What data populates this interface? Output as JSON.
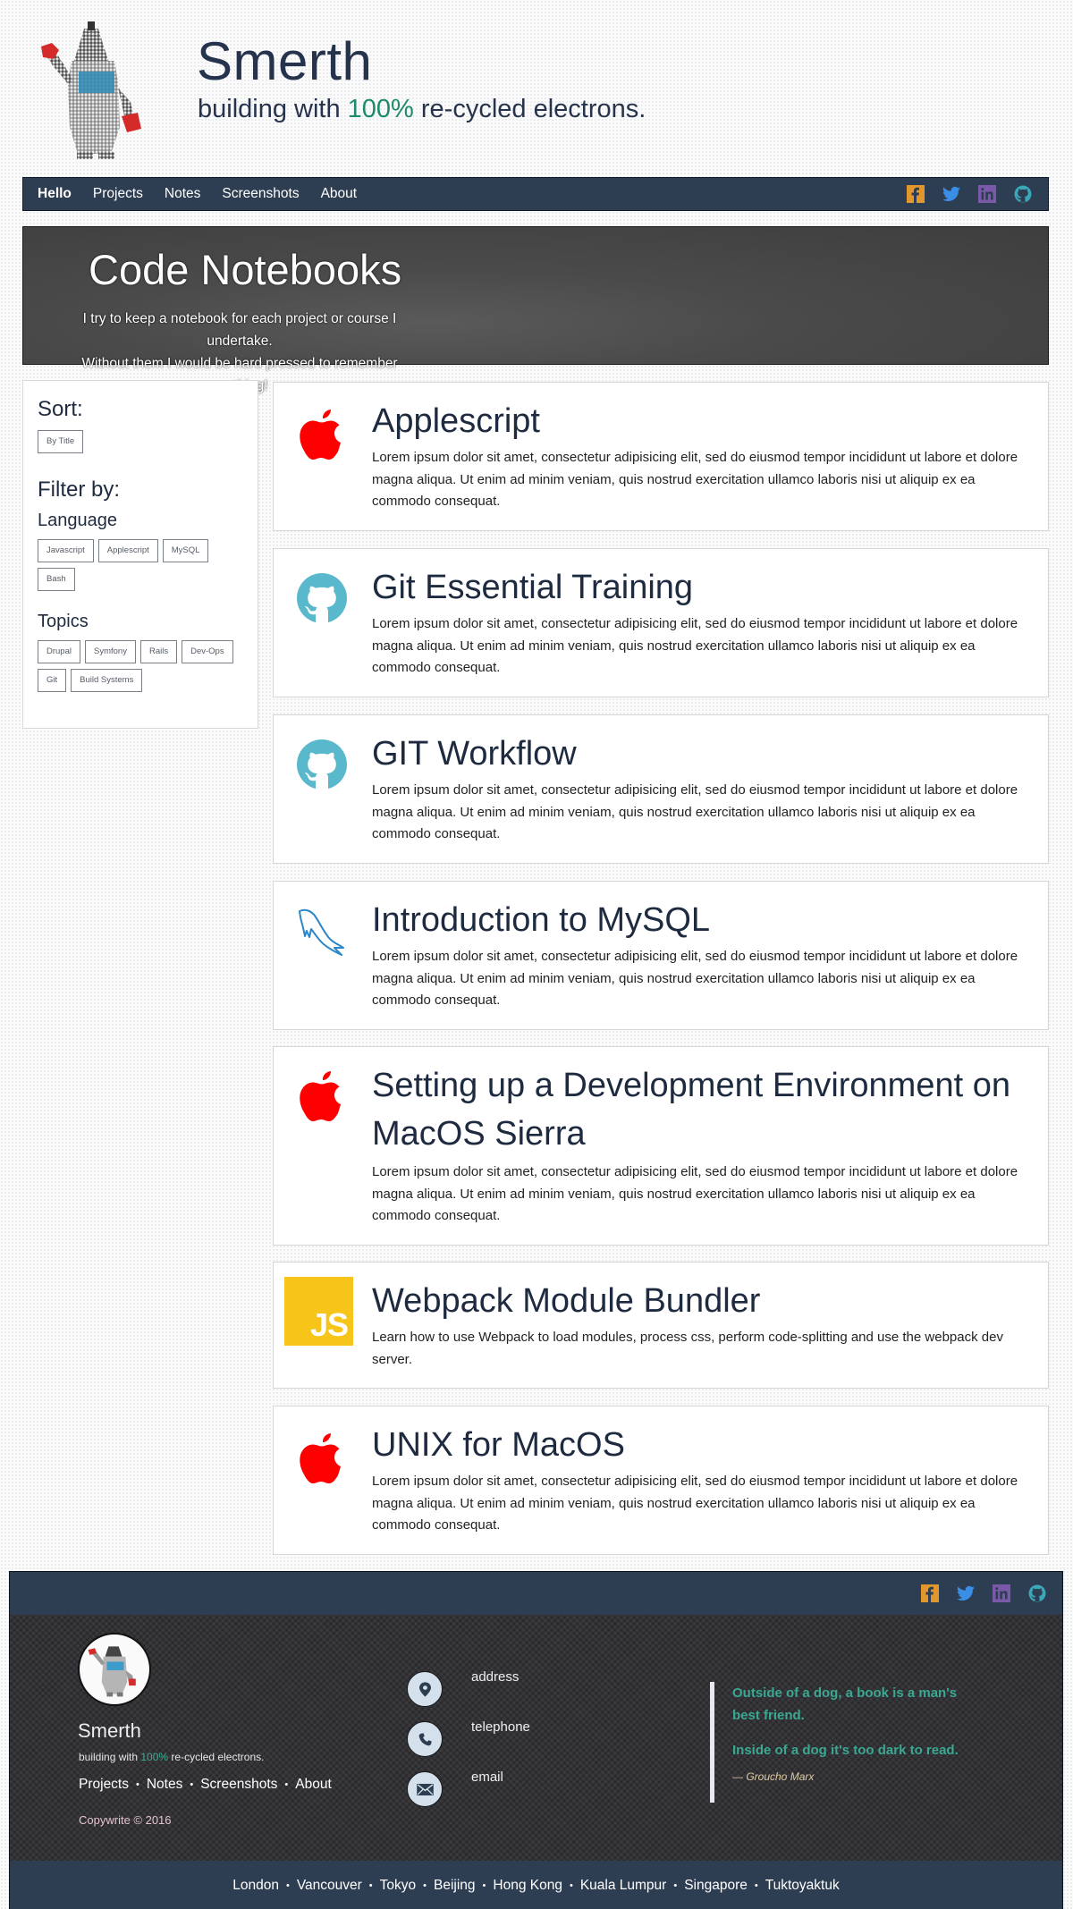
{
  "header": {
    "logo_icon": "pixel-robot-icon",
    "title": "Smerth",
    "tagline_before": "building with ",
    "tagline_accent": "100%",
    "tagline_after": " re-cycled electrons."
  },
  "nav": {
    "items": [
      {
        "label": "Hello",
        "active": true
      },
      {
        "label": "Projects"
      },
      {
        "label": "Notes"
      },
      {
        "label": "Screenshots"
      },
      {
        "label": "About"
      }
    ],
    "social": [
      {
        "name": "facebook-icon",
        "color": "#e1962e"
      },
      {
        "name": "twitter-icon",
        "color": "#3a8ee6"
      },
      {
        "name": "linkedin-icon",
        "color": "#7a5aa8"
      },
      {
        "name": "github-icon",
        "color": "#3aa8b8"
      }
    ]
  },
  "banner": {
    "title": "Code Notebooks",
    "line1": "I try to keep a notebook for each project or course I undertake.",
    "line2": "Without them I would be hard pressed to remember anything!"
  },
  "sidebar": {
    "sort_heading": "Sort:",
    "sort_options": [
      "By Title"
    ],
    "filter_heading": "Filter by:",
    "language_heading": "Language",
    "languages": [
      "Javascript",
      "Applescript",
      "MySQL",
      "Bash"
    ],
    "topics_heading": "Topics",
    "topics": [
      "Drupal",
      "Symfony",
      "Rails",
      "Dev-Ops",
      "Git",
      "Build Systems"
    ]
  },
  "cards": [
    {
      "icon": "apple-icon",
      "title": "Applescript",
      "description": "Lorem ipsum dolor sit amet, consectetur adipisicing elit, sed do eiusmod tempor incididunt ut labore et dolore magna aliqua. Ut enim ad minim veniam, quis nostrud exercitation ullamco laboris nisi ut aliquip ex ea commodo consequat."
    },
    {
      "icon": "github-icon",
      "title": "Git Essential Training",
      "description": "Lorem ipsum dolor sit amet, consectetur adipisicing elit, sed do eiusmod tempor incididunt ut labore et dolore magna aliqua. Ut enim ad minim veniam, quis nostrud exercitation ullamco laboris nisi ut aliquip ex ea commodo consequat."
    },
    {
      "icon": "github-icon",
      "title": "GIT Workflow",
      "description": "Lorem ipsum dolor sit amet, consectetur adipisicing elit, sed do eiusmod tempor incididunt ut labore et dolore magna aliqua. Ut enim ad minim veniam, quis nostrud exercitation ullamco laboris nisi ut aliquip ex ea commodo consequat."
    },
    {
      "icon": "mysql-dolphin-icon",
      "title": "Introduction to MySQL",
      "description": "Lorem ipsum dolor sit amet, consectetur adipisicing elit, sed do eiusmod tempor incididunt ut labore et dolore magna aliqua. Ut enim ad minim veniam, quis nostrud exercitation ullamco laboris nisi ut aliquip ex ea commodo consequat."
    },
    {
      "icon": "apple-icon",
      "title": "Setting up a Development Environment on MacOS Sierra",
      "description": "Lorem ipsum dolor sit amet, consectetur adipisicing elit, sed do eiusmod tempor incididunt ut labore et dolore magna aliqua. Ut enim ad minim veniam, quis nostrud exercitation ullamco laboris nisi ut aliquip ex ea commodo consequat."
    },
    {
      "icon": "javascript-icon",
      "icon_text": "JS",
      "title": "Webpack Module Bundler",
      "description": "Learn how to use Webpack to load modules, process css, perform code-splitting and use the webpack dev server."
    },
    {
      "icon": "apple-icon",
      "title": "UNIX for MacOS",
      "description": "Lorem ipsum dolor sit amet, consectetur adipisicing elit, sed do eiusmod tempor incididunt ut labore et dolore magna aliqua. Ut enim ad minim veniam, quis nostrud exercitation ullamco laboris nisi ut aliquip ex ea commodo consequat."
    }
  ],
  "footer": {
    "name": "Smerth",
    "tagline_before": "building with ",
    "tagline_accent": "100%",
    "tagline_after": " re-cycled electrons.",
    "links": [
      "Projects",
      "Notes",
      "Screenshots",
      "About"
    ],
    "separator": "•",
    "copyright": "Copywrite © 2016",
    "contacts": [
      {
        "icon": "map-pin-icon",
        "label": "address"
      },
      {
        "icon": "phone-icon",
        "label": "telephone"
      },
      {
        "icon": "envelope-icon",
        "label": "email"
      }
    ],
    "quote": {
      "line1": "Outside of a dog, a book is a man's best friend.",
      "line2": "Inside of a dog it's too dark to read.",
      "cite": "— Groucho Marx"
    },
    "cities": [
      "London",
      "Vancouver",
      "Tokyo",
      "Beijing",
      "Hong Kong",
      "Kuala Lumpur",
      "Singapore",
      "Tuktoyaktuk"
    ]
  },
  "colors": {
    "navy": "#2e3e52",
    "accent_green": "#1d8a6c",
    "quote_teal": "#3aa892",
    "apple_red": "#ff0000",
    "github_teal": "#5ab8cc",
    "js_yellow": "#f7c51a"
  }
}
